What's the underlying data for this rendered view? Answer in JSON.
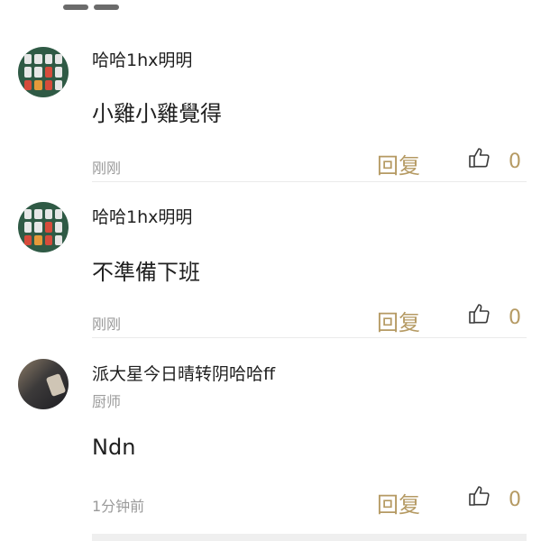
{
  "comments": [
    {
      "username": "哈哈1hx明明",
      "text": "小雞小雞覺得",
      "time": "刚刚",
      "reply_label": "回复",
      "like_count": "0",
      "avatar": "app-grid-avatar"
    },
    {
      "username": "哈哈1hx明明",
      "text": "不準備下班",
      "time": "刚刚",
      "reply_label": "回复",
      "like_count": "0",
      "avatar": "app-grid-avatar"
    },
    {
      "username": "派大星今日晴转阴哈哈ff",
      "subtitle": "厨师",
      "text": "Ndn",
      "time": "1分钟前",
      "reply_label": "回复",
      "like_count": "0",
      "avatar": "photo-avatar"
    }
  ],
  "colors": {
    "accent": "#b59a63",
    "muted": "#9a9a9a",
    "text": "#1f1f1f"
  },
  "icons": {
    "like": "thumbs-up-icon"
  }
}
